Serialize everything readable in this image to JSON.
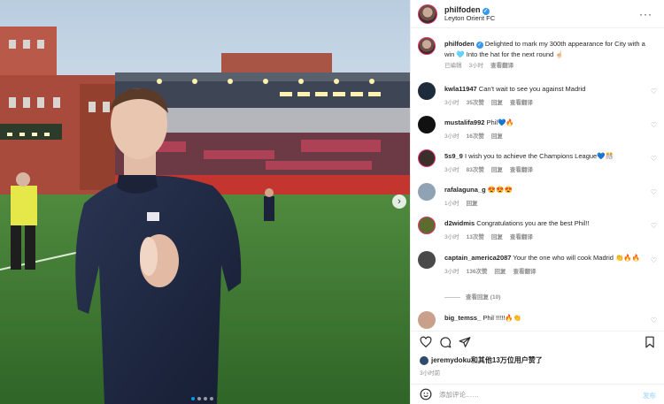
{
  "post": {
    "author": "philfoden",
    "location": "Leyton Orient FC",
    "caption_user": "philfoden",
    "caption_text": "Delighted to mark my 300th appearance for City with a win 🩵 Into the hat for the next round ☝🏻",
    "caption_meta": {
      "edited": "已编辑",
      "time": "3小时",
      "translate": "查看翻译"
    },
    "likes": "jeremydoku和其他13万位用户赞了",
    "post_time": "3小时前",
    "comment_placeholder": "添加评论……",
    "post_button": "发布",
    "more_icon": "more-dots-icon"
  },
  "comments": [
    {
      "user": "kwla11947",
      "text": "Can't wait to see you against Madrid",
      "time": "3小时",
      "likes": "35次赞",
      "reply": "回复",
      "translate": "查看翻译",
      "avatar_color": "#1d2b3a"
    },
    {
      "user": "mustalifa992",
      "text": "Phil💙🔥",
      "time": "3小时",
      "likes": "16次赞",
      "reply": "回复",
      "translate": "",
      "avatar_color": "#111111"
    },
    {
      "user": "5s9_9",
      "text": "I wish you to achieve the Champions League💙🎊",
      "time": "3小时",
      "likes": "83次赞",
      "reply": "回复",
      "translate": "查看翻译",
      "avatar_color": "#3a2f2a"
    },
    {
      "user": "rafalaguna_g",
      "text": "😍😍😍",
      "time": "1小时",
      "likes": "",
      "reply": "回复",
      "translate": "",
      "avatar_color": "#8fa3b5"
    },
    {
      "user": "d2widmis",
      "text": "Congratulations you are the best Phil!!",
      "time": "3小时",
      "likes": "13次赞",
      "reply": "回复",
      "translate": "查看翻译",
      "avatar_color": "#5d6b2e"
    },
    {
      "user": "captain_america2087",
      "text": "Your the one who will cook Madrid 👏🔥🔥",
      "time": "3小时",
      "likes": "136次赞",
      "reply": "回复",
      "translate": "查看翻译",
      "avatar_color": "#4a4a4a"
    },
    {
      "user": "big_temss_",
      "text": "Phil !!!!!🔥👏",
      "time": "",
      "likes": "",
      "reply": "",
      "translate": "",
      "avatar_color": "#c9a08a"
    }
  ],
  "view_replies": "查看回复 (10)",
  "carousel": {
    "slide_count": 4,
    "active_index": 0,
    "next_icon": "chevron-right-icon"
  },
  "colors": {
    "verified": "#3897f0",
    "accent": "#0095f6",
    "muted": "#8e8e8e",
    "text": "#262626"
  }
}
